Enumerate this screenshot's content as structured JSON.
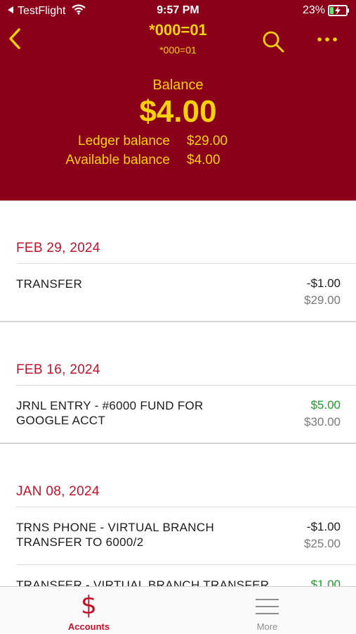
{
  "status_bar": {
    "back_app": "TestFlight",
    "time": "9:57 PM",
    "battery": "23%",
    "battery_level": 0.23,
    "icons": [
      "back-triangle-icon",
      "wifi-icon",
      "battery-charging-icon"
    ]
  },
  "nav": {
    "title": "*000=01",
    "subtitle": "*000=01",
    "icons": [
      "chevron-left-icon",
      "search-icon",
      "more-icon"
    ]
  },
  "balance": {
    "label": "Balance",
    "amount": "$4.00",
    "ledger_label": "Ledger balance",
    "ledger_value": "$29.00",
    "available_label": "Available balance",
    "available_value": "$4.00"
  },
  "transactions": [
    {
      "date": "FEB 29, 2024",
      "items": [
        {
          "description": "TRANSFER",
          "amount": "-$1.00",
          "balance": "$29.00",
          "positive": false
        }
      ]
    },
    {
      "date": "FEB 16, 2024",
      "items": [
        {
          "description": "JRNL ENTRY - #6000 FUND FOR GOOGLE ACCT",
          "amount": "$5.00",
          "balance": "$30.00",
          "positive": true
        }
      ]
    },
    {
      "date": "JAN 08, 2024",
      "items": [
        {
          "description": "TRNS PHONE - VIRTUAL BRANCH TRANSFER TO 6000/2",
          "amount": "-$1.00",
          "balance": "$25.00",
          "positive": false
        },
        {
          "description": "TRANSFER - VIRTUAL BRANCH TRANSFER",
          "amount": "$1.00",
          "balance": "",
          "positive": true
        }
      ]
    }
  ],
  "tab_bar": {
    "tabs": [
      {
        "label": "Accounts",
        "icon": "dollar-icon",
        "active": true
      },
      {
        "label": "More",
        "icon": "menu-lines-icon",
        "active": false
      }
    ]
  },
  "colors": {
    "header_bg": "#8a0019",
    "header_text": "#f7d10a",
    "date_red": "#c4122b",
    "positive_green": "#1e9e2a"
  }
}
